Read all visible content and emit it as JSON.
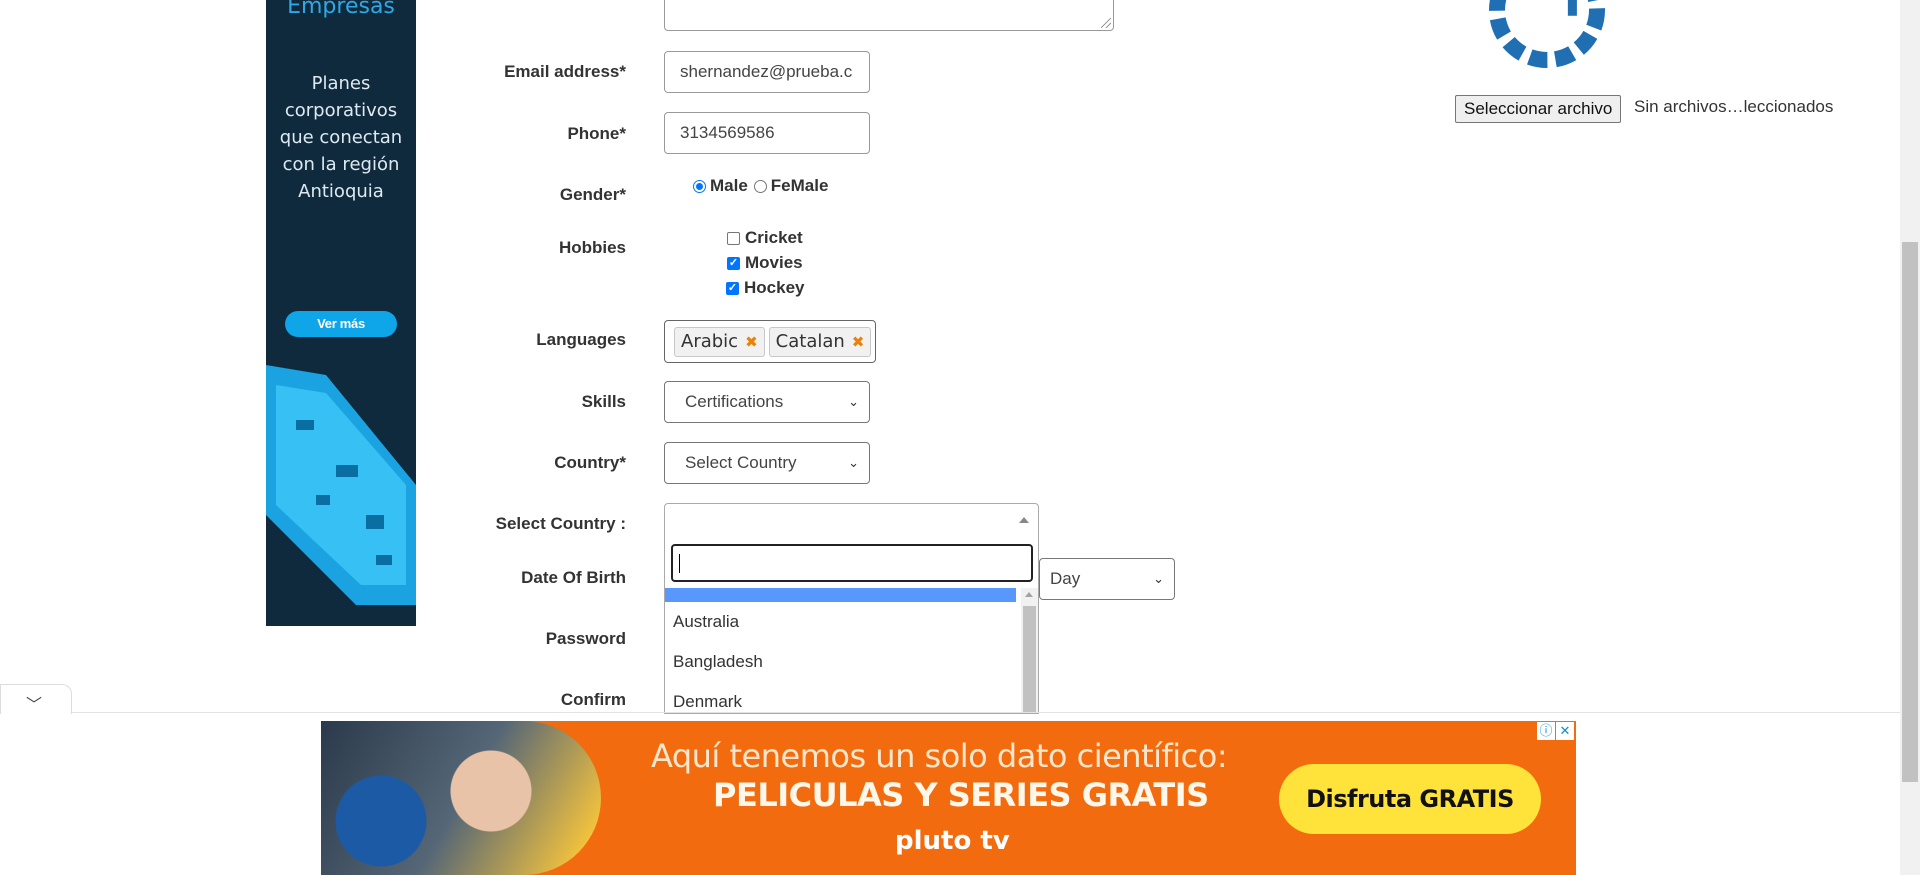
{
  "side_ad": {
    "brand": "Empresas",
    "copy": "Planes corporativos que conectan con la región Antioquia",
    "button_label": "Ver más"
  },
  "form": {
    "email_label": "Email address*",
    "email_value": "shernandez@prueba.c",
    "phone_label": "Phone*",
    "phone_value": "3134569586",
    "gender_label": "Gender*",
    "gender_options": [
      "Male",
      "FeMale"
    ],
    "gender_selected": "Male",
    "hobbies_label": "Hobbies",
    "hobbies": [
      {
        "label": "Cricket",
        "checked": false
      },
      {
        "label": "Movies",
        "checked": true
      },
      {
        "label": "Hockey",
        "checked": true
      }
    ],
    "languages_label": "Languages",
    "languages": [
      "Arabic",
      "Catalan"
    ],
    "skills_label": "Skills",
    "skills_value": "Certifications",
    "country_label": "Country*",
    "country_value": "Select Country",
    "select_country_label": "Select Country :",
    "dob_label": "Date Of Birth",
    "dob_day": "Day",
    "password_label": "Password",
    "confirm_label": "Confirm"
  },
  "country_dropdown": {
    "search_value": "",
    "options": [
      "",
      "Australia",
      "Bangladesh",
      "Denmark"
    ]
  },
  "upload": {
    "button_label": "Seleccionar archivo",
    "status": "Sin archivos…leccionados"
  },
  "bottom_ad": {
    "line1": "Aquí tenemos un solo dato científico:",
    "line2": "PELICULAS Y SERIES GRATIS",
    "brand": "pluto tv",
    "cta": "Disfruta GRATIS",
    "info_icon": "ⓘ",
    "close_icon": "✕"
  },
  "colors": {
    "accent": "#0075ff",
    "ad_orange": "#f26b0f",
    "highlight": "#5897fb"
  }
}
